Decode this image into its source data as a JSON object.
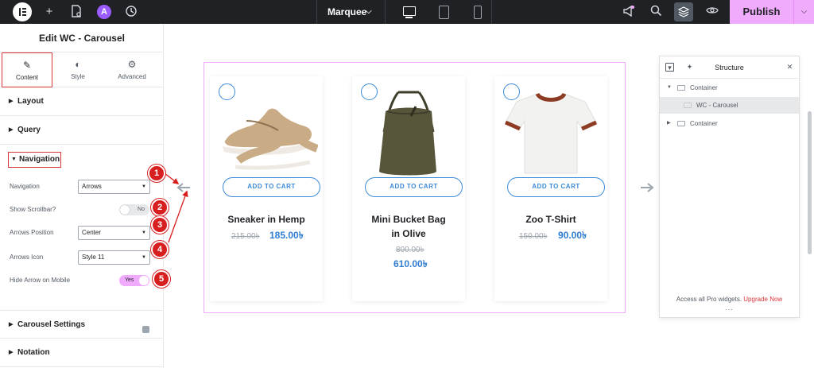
{
  "topbar": {
    "page_name": "Marquee",
    "publish_label": "Publish",
    "ai_badge": "A",
    "icons": [
      "elementor-logo-icon",
      "add-icon",
      "page-settings-icon",
      "ai-icon",
      "history-icon",
      "desktop-icon",
      "tablet-icon",
      "mobile-icon",
      "notifications-icon",
      "search-icon",
      "structure-icon",
      "preview-icon"
    ]
  },
  "panel": {
    "title": "Edit WC - Carousel",
    "tabs": [
      {
        "label": "Content",
        "icon": "pencil-icon"
      },
      {
        "label": "Style",
        "icon": "style-icon"
      },
      {
        "label": "Advanced",
        "icon": "gear-icon"
      }
    ],
    "sections": {
      "layout": "Layout",
      "query": "Query",
      "navigation": "Navigation",
      "carousel_settings": "Carousel Settings",
      "notation": "Notation"
    },
    "controls": {
      "navigation_label": "Navigation",
      "navigation_value": "Arrows",
      "scrollbar_label": "Show Scrollbar?",
      "scrollbar_value": "No",
      "arrows_position_label": "Arrows Position",
      "arrows_position_value": "Center",
      "arrows_icon_label": "Arrows Icon",
      "arrows_icon_value": "Style 11",
      "hide_arrow_label": "Hide Arrow on Mobile",
      "hide_arrow_value": "Yes"
    }
  },
  "products": [
    {
      "name": "Sneaker in Hemp",
      "old_price": "215.00৳",
      "price": "185.00৳",
      "button": "ADD TO CART"
    },
    {
      "name_line1": "Mini Bucket Bag",
      "name_line2": "in Olive",
      "old_price": "800.00৳",
      "price": "610.00৳",
      "button": "ADD TO CART"
    },
    {
      "name": "Zoo T-Shirt",
      "old_price": "150.00৳",
      "price": "90.00৳",
      "button": "ADD TO CART"
    }
  ],
  "structure": {
    "title": "Structure",
    "items": [
      "Container",
      "WC - Carousel",
      "Container"
    ],
    "footer_text": "Access all Pro widgets.",
    "footer_link": "Upgrade Now",
    "dots": "···"
  },
  "markers": [
    "1",
    "2",
    "3",
    "4",
    "5"
  ],
  "colors": {
    "accent": "#f0abfc",
    "annotation": "#d71f1f",
    "price_blue": "#2e7dd1",
    "topbar": "#1f2124"
  }
}
